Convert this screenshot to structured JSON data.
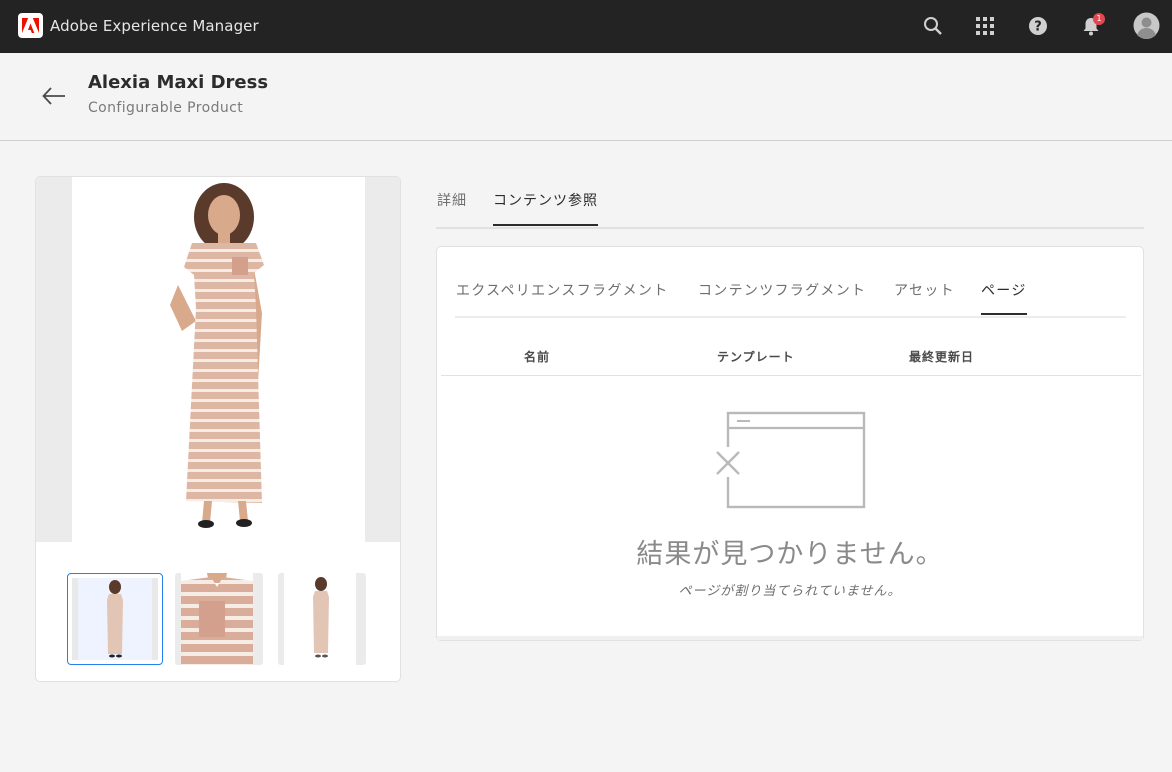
{
  "app": {
    "title": "Adobe Experience Manager",
    "brand_color": "#eb1000",
    "notification_count": "1",
    "icons": [
      "search-icon",
      "apps-grid-icon",
      "help-icon",
      "bell-icon",
      "avatar"
    ]
  },
  "header": {
    "title": "Alexia Maxi Dress",
    "subtitle": "Configurable Product"
  },
  "tabs": [
    {
      "label": "詳細",
      "active": false
    },
    {
      "label": "コンテンツ参照",
      "active": true
    }
  ],
  "subtabs": [
    {
      "label": "エクスペリエンスフラグメント",
      "active": false
    },
    {
      "label": "コンテンツフラグメント",
      "active": false
    },
    {
      "label": "アセット",
      "active": false
    },
    {
      "label": "ページ",
      "active": true
    }
  ],
  "table": {
    "columns": [
      "名前",
      "テンプレート",
      "最終更新日"
    ],
    "rows": []
  },
  "empty_state": {
    "title": "結果が見つかりません。",
    "message": "ページが割り当てられていません。"
  },
  "gallery": {
    "selected_index": 0,
    "thumbnails": [
      "dress-front",
      "dress-detail",
      "dress-back"
    ]
  }
}
